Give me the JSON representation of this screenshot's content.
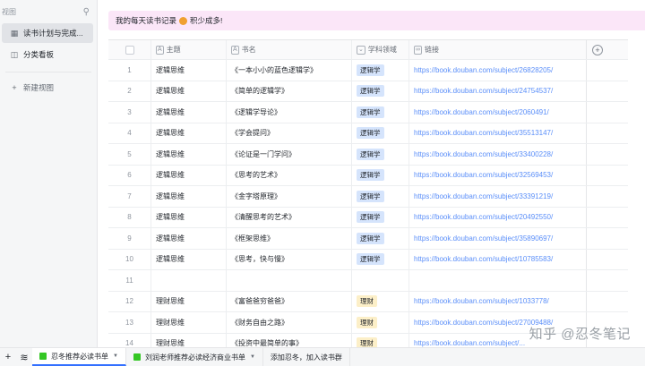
{
  "sidebar": {
    "header_label": "视图",
    "pin_icon": "pin-icon",
    "items": [
      {
        "label": "读书计划与完成...",
        "icon": "grid-icon",
        "active": true
      },
      {
        "label": "分类看板",
        "icon": "kanban-icon",
        "active": false
      }
    ],
    "new_view_label": "新建视图"
  },
  "banner": {
    "text_before": "我的每天读书记录",
    "text_after": "积少成多!"
  },
  "table": {
    "headers": {
      "topic": "主题",
      "book": "书名",
      "field": "学科领域",
      "link": "链接"
    },
    "rows": [
      {
        "num": "1",
        "topic": "逻辑思维",
        "book": "《一本小小的蓝色逻辑学》",
        "field": "逻辑学",
        "link": "https://book.douban.com/subject/26828205/"
      },
      {
        "num": "2",
        "topic": "逻辑思维",
        "book": "《简单的逻辑学》",
        "field": "逻辑学",
        "link": "https://book.douban.com/subject/24754537/"
      },
      {
        "num": "3",
        "topic": "逻辑思维",
        "book": "《逻辑学导论》",
        "field": "逻辑学",
        "link": "https://book.douban.com/subject/2060491/"
      },
      {
        "num": "4",
        "topic": "逻辑思维",
        "book": "《学会提问》",
        "field": "逻辑学",
        "link": "https://book.douban.com/subject/35513147/"
      },
      {
        "num": "5",
        "topic": "逻辑思维",
        "book": "《论证是一门学问》",
        "field": "逻辑学",
        "link": "https://book.douban.com/subject/33400228/"
      },
      {
        "num": "6",
        "topic": "逻辑思维",
        "book": "《思考的艺术》",
        "field": "逻辑学",
        "link": "https://book.douban.com/subject/32569453/"
      },
      {
        "num": "7",
        "topic": "逻辑思维",
        "book": "《金字塔原理》",
        "field": "逻辑学",
        "link": "https://book.douban.com/subject/33391219/"
      },
      {
        "num": "8",
        "topic": "逻辑思维",
        "book": "《清醒思考的艺术》",
        "field": "逻辑学",
        "link": "https://book.douban.com/subject/20492550/"
      },
      {
        "num": "9",
        "topic": "逻辑思维",
        "book": "《框架思维》",
        "field": "逻辑学",
        "link": "https://book.douban.com/subject/35890697/"
      },
      {
        "num": "10",
        "topic": "逻辑思维",
        "book": "《思考，快与慢》",
        "field": "逻辑学",
        "link": "https://book.douban.com/subject/10785583/"
      },
      {
        "num": "11",
        "topic": "",
        "book": "",
        "field": "",
        "link": ""
      },
      {
        "num": "12",
        "topic": "理财思维",
        "book": "《富爸爸穷爸爸》",
        "field": "理财",
        "link": "https://book.douban.com/subject/1033778/"
      },
      {
        "num": "13",
        "topic": "理财思维",
        "book": "《财务自由之路》",
        "field": "理财",
        "link": "https://book.douban.com/subject/27009488/"
      },
      {
        "num": "14",
        "topic": "理财思维",
        "book": "《投资中最简单的事》",
        "field": "理财",
        "link": "https://book.douban.com/subject/..."
      }
    ]
  },
  "bottombar": {
    "tabs": [
      {
        "label": "忍冬推荐必读书单",
        "active": true
      },
      {
        "label": "刘润老师推荐必读经济商业书单",
        "active": false
      },
      {
        "label": "添加忍冬，加入读书群",
        "active": false
      }
    ]
  },
  "watermark": "知乎 @忍冬笔记",
  "colors": {
    "banner_bg": "#fbe6f8",
    "tag_logic": "#d5e4fc",
    "tag_finance": "#fcefc8",
    "link": "#5b8ff9",
    "active_tab": "#3370ff"
  }
}
